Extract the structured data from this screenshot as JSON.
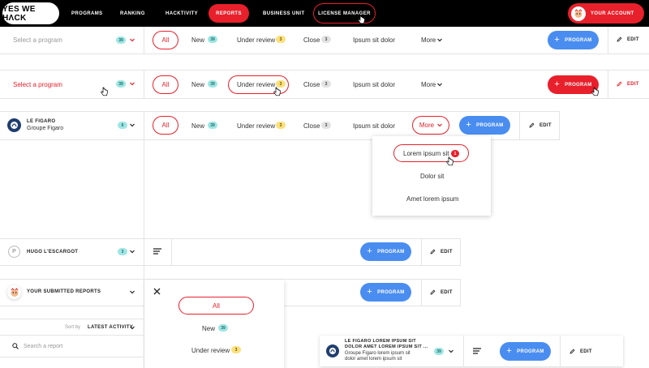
{
  "topbar": {
    "logo": "YES WE HΛCK",
    "nav": [
      "PROGRAMS",
      "RANKING",
      "HACKTIVITY",
      "REPORTS",
      "BUSINESS UNIT",
      "LICENSE MANAGER"
    ],
    "account": "YOUR ACCOUNT"
  },
  "filters": {
    "all": "All",
    "new": "New",
    "new_count": "39",
    "under_review": "Under review",
    "under_review_count": "3",
    "close": "Close",
    "close_count": "3",
    "ipsum": "Ipsum sit dolor",
    "more": "More"
  },
  "program_btn": "PROGRAM",
  "edit": "EDIT",
  "row1": {
    "select": "Select a program",
    "count": "39"
  },
  "row2": {
    "select": "Select a program",
    "count": "39"
  },
  "row3": {
    "name": "LE FIGARO",
    "sub": "Groupe Figaro",
    "count": "6"
  },
  "more_menu": {
    "item1": "Lorem ipsum sit",
    "item1_badge": "1",
    "item2": "Dolor sit",
    "item3": "Amet lorem ipsum"
  },
  "row4": {
    "initial": "P",
    "name": "HUGO L'ESCARGOT",
    "count": "3"
  },
  "row5": {
    "name": "YOUR SUBMITTED REPORTS"
  },
  "sort": {
    "label": "Sort by",
    "value": "LATEST ACTIVITY"
  },
  "search": {
    "placeholder": "Search a report"
  },
  "mobile_filters": {
    "all": "All",
    "new": "New",
    "new_count": "39",
    "under_review": "Under review",
    "under_review_count": "3"
  },
  "long_row": {
    "line1": "LE FIGARO LOREM IPSUM SIT",
    "line2": "DOLOR AMET LOREM IPSUM SIT ...",
    "line3": "Groupe Figaro lorem ipsum sit",
    "line4": "dolor amet lorem ipsum sit",
    "count": "39"
  },
  "colors": {
    "accent": "#e8202b",
    "blue": "#4a8df0",
    "teal_badge": "#9fe6e4",
    "yellow_badge": "#fbe07c"
  },
  "icons": [
    "pointer-hand-icon",
    "chevron-down-icon",
    "plus-icon",
    "pencil-icon",
    "close-icon",
    "hamburger-icon",
    "search-icon"
  ]
}
